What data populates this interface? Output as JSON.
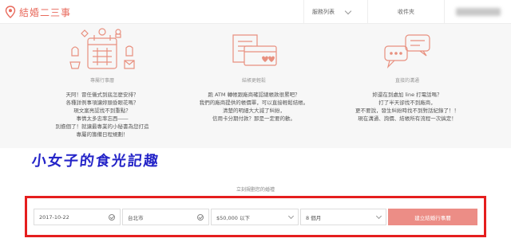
{
  "brand": {
    "name": "結婚二三事",
    "accent": "#e86a5c"
  },
  "nav": {
    "services_label": "服務列表",
    "inbox_label": "收件夾"
  },
  "features": [
    {
      "title": "專屬行事曆",
      "icon": "wedding-calendar-icon",
      "lines": [
        "天阿！冒任儀式到底怎麼安排？",
        "各種詳例事項讓妳頭昏眼花嗎？",
        "現文案亮認找不到重點？",
        "事情太多忠率忘西――",
        "別擔個了！就讓最專業的小秘書為您打造",
        "專屬的籌備日程規劃！"
      ]
    },
    {
      "title": "結帳更輕鬆",
      "icon": "payment-cards-icon",
      "lines": [
        "跑 ATM 轉帳跟廠商確認總帳款很累吧？",
        "我們的廠商提供的帳價單，可以直接輕鬆結帳。",
        "清楚的明細大大減了糾紛，",
        "信用卡分期付款？那是一定要的歡。"
      ]
    },
    {
      "title": "直接的溝通",
      "icon": "chat-bubbles-icon",
      "lines": [
        "妳還在到處加 line 打電話嗎？",
        "打了半天卻找不到廠商，",
        "更不要說，發生糾紛時找不到對話紀錄了！！",
        "現在溝通、詢價、結帳所有流程一次搞定！"
      ]
    }
  ],
  "watermark": "小女子的食光記趣",
  "booking": {
    "caption": "立刻規劃您的婚禮",
    "date_value": "2017-10-22",
    "city_value": "台北市",
    "budget_value": "$50,000 以下",
    "months_value": "8 個月",
    "submit_label": "建立結婚行事曆",
    "frame_color": "#e51e1e",
    "button_color": "#ec8d86"
  }
}
